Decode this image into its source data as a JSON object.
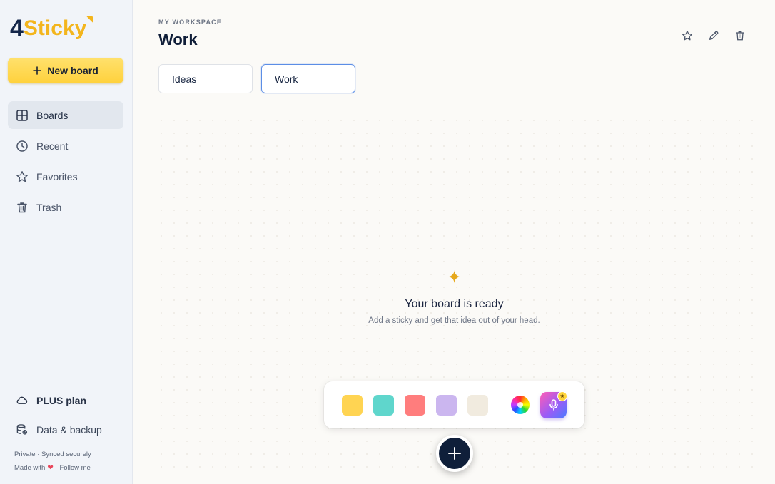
{
  "app": {
    "logo_num": "4",
    "logo_word": "Sticky"
  },
  "sidebar": {
    "new_board_label": "New board",
    "items": [
      {
        "label": "Boards",
        "icon": "grid-icon",
        "active": true
      },
      {
        "label": "Recent",
        "icon": "clock-icon",
        "active": false
      },
      {
        "label": "Favorites",
        "icon": "star-icon",
        "active": false
      },
      {
        "label": "Trash",
        "icon": "trash-icon",
        "active": false
      }
    ],
    "plus_plan_label": "PLUS plan",
    "data_backup_label": "Data & backup",
    "footer_privacy": "Private · Synced securely",
    "footer_made_with": "Made with",
    "footer_follow": "· Follow me"
  },
  "header": {
    "eyebrow": "MY WORKSPACE",
    "title": "Work",
    "actions": [
      "star-icon",
      "pencil-icon",
      "trash-icon"
    ]
  },
  "tabs": [
    {
      "label": "Ideas",
      "active": false
    },
    {
      "label": "Work",
      "active": true
    }
  ],
  "empty_state": {
    "icon": "sparkle-icon",
    "title": "Your board is ready",
    "subtitle": "Add a sticky and get that idea out of your head."
  },
  "toolbar": {
    "swatches": [
      "#ffd452",
      "#5fd6cc",
      "#ff7d7d",
      "#cbb6ef",
      "#f1ebdf"
    ],
    "color_wheel": "color-wheel-icon",
    "voice_button": "microphone-icon"
  },
  "colors": {
    "accent": "#ffd13c",
    "brand_dark": "#14264a",
    "active_tab_border": "#5c8ee6"
  }
}
